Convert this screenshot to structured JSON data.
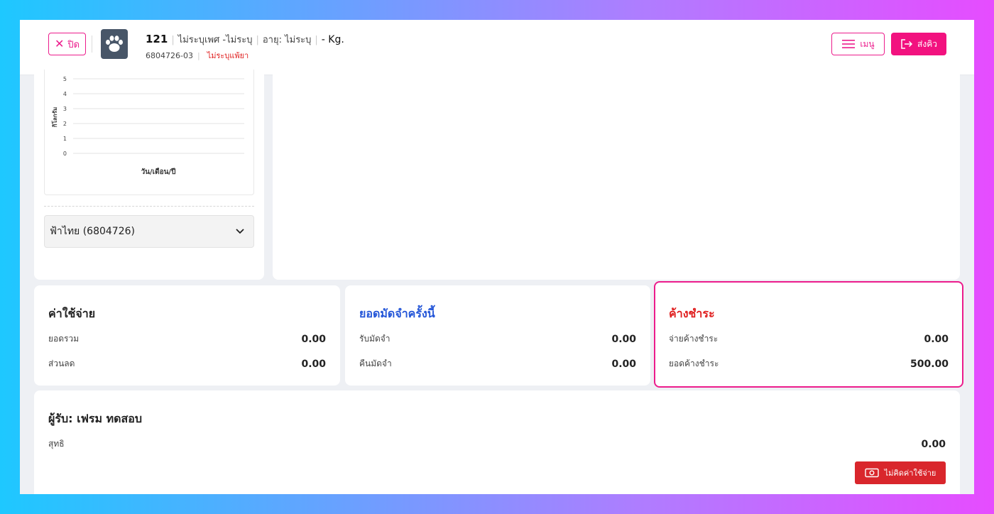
{
  "header": {
    "close_label": "ปิด",
    "pet_id": "121",
    "gender": "ไม่ระบุเพศ -ไม่ระบุ",
    "age": "อายุ: ไม่ระบุ",
    "weight": "- Kg.",
    "code": "6804726-03",
    "allergy": "ไม่ระบุแพ้ยา",
    "menu_label": "เมนู",
    "send_label": "ส่งคิว"
  },
  "weight_chart": {
    "owner_select": "ฟ้าไทย (6804726)"
  },
  "chart_data": {
    "type": "line",
    "x": [],
    "series": [],
    "title": "",
    "xlabel": "วัน/เดือน/ปี",
    "ylabel": "กิโลกรัม",
    "ylim": [
      0,
      5
    ],
    "yticks": [
      "0",
      "1",
      "2",
      "3",
      "4",
      "5"
    ],
    "grid": true
  },
  "expenses": {
    "title": "ค่าใช้จ่าย",
    "total_label": "ยอดรวม",
    "total_value": "0.00",
    "discount_label": "ส่วนลด",
    "discount_value": "0.00"
  },
  "deposit": {
    "title": "ยอดมัดจำครั้งนี้",
    "receive_label": "รับมัดจำ",
    "receive_value": "0.00",
    "refund_label": "คืนมัดจำ",
    "refund_value": "0.00"
  },
  "outstanding": {
    "title": "ค้างชำระ",
    "pay_label": "จ่ายค้างชำระ",
    "pay_value": "0.00",
    "balance_label": "ยอดค้างชำระ",
    "balance_value": "500.00"
  },
  "receiver": {
    "title": "ผู้รับ: เฟรม ทดสอบ",
    "net_label": "สุทธิ",
    "net_value": "0.00",
    "no_charge_label": "ไม่คิดค่าใช้จ่าย"
  },
  "colors": {
    "accent": "#ec1c8c",
    "deposit_title": "#2456d8",
    "outstanding_title": "#e02020",
    "danger_button": "#d9262c"
  }
}
